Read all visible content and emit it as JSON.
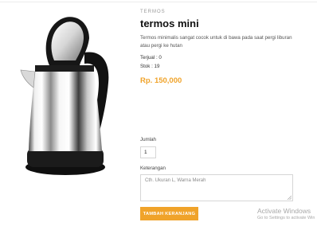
{
  "product": {
    "category": "TERMOS",
    "title": "termos mini",
    "description": "Termos minimalis sangat cocok untuk di bawa pada saat pergi liburan atau pergi ke hutan",
    "sold": "Terjual : 0",
    "stock": "Stok : 19",
    "price": "Rp. 150,000",
    "image_icon": "electric-kettle-image"
  },
  "form": {
    "quantity_label": "Jumlah",
    "quantity_value": "1",
    "note_label": "Keterangan",
    "note_placeholder": "Cth. Ukuran L, Warna Merah",
    "add_button_label": "TAMBAH KERANJANG"
  },
  "watermark": {
    "title": "Activate Windows",
    "subtitle": "Go to Settings to activate Win"
  },
  "colors": {
    "accent": "#f0a32a",
    "text": "#111111",
    "muted": "#9a9a9a"
  }
}
